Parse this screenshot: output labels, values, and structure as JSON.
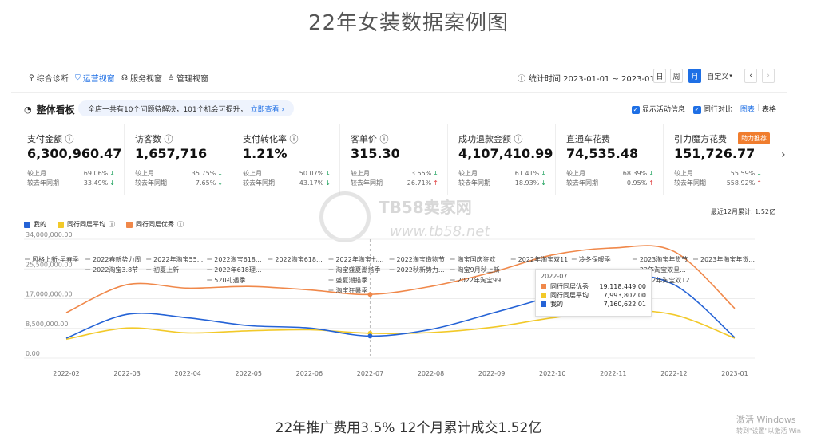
{
  "page_title": "22年女装数据案例图",
  "nav": {
    "tabs": [
      {
        "label": "综合诊断"
      },
      {
        "label": "运营视窗"
      },
      {
        "label": "服务视窗"
      },
      {
        "label": "管理视窗"
      }
    ],
    "stat_time": "统计时间 2023-01-01 ~ 2023-01-31",
    "period_buttons": [
      "日",
      "周",
      "月",
      "自定义"
    ],
    "prev": "‹",
    "next": "›"
  },
  "overview": {
    "title": "整体看板",
    "notice": "全店一共有10个问题待解决，101个机会可提升，",
    "notice_link": "立即查看 ›",
    "opt_activity": "显示活动信息",
    "opt_peer": "同行对比",
    "opt_chart": "图表",
    "opt_sep": "|",
    "opt_table": "表格"
  },
  "cards": [
    {
      "name": "支付金额 ⓘ",
      "value": "6,300,960.47",
      "r1_label": "较上月",
      "r1_val": "69.06%",
      "r1_dir": "↓",
      "r2_label": "较去年同期",
      "r2_val": "33.49%",
      "r2_dir": "↓"
    },
    {
      "name": "访客数 ⓘ",
      "value": "1,657,716",
      "r1_label": "较上月",
      "r1_val": "35.75%",
      "r1_dir": "↓",
      "r2_label": "较去年同期",
      "r2_val": "7.65%",
      "r2_dir": "↓"
    },
    {
      "name": "支付转化率 ⓘ",
      "value": "1.21%",
      "r1_label": "较上月",
      "r1_val": "50.07%",
      "r1_dir": "↓",
      "r2_label": "较去年同期",
      "r2_val": "43.17%",
      "r2_dir": "↓"
    },
    {
      "name": "客单价 ⓘ",
      "value": "315.30",
      "r1_label": "较上月",
      "r1_val": "3.55%",
      "r1_dir": "↓",
      "r2_label": "较去年同期",
      "r2_val": "26.71%",
      "r2_dir": "↑"
    },
    {
      "name": "成功退款金额 ⓘ",
      "value": "4,107,410.99",
      "r1_label": "较上月",
      "r1_val": "61.41%",
      "r1_dir": "↓",
      "r2_label": "较去年同期",
      "r2_val": "18.93%",
      "r2_dir": "↓"
    },
    {
      "name": "直通车花费",
      "value": "74,535.48",
      "r1_label": "较上月",
      "r1_val": "68.39%",
      "r1_dir": "↓",
      "r2_label": "较去年同期",
      "r2_val": "0.95%",
      "r2_dir": "↑"
    },
    {
      "name": "引力魔方花费",
      "value": "151,726.77",
      "r1_label": "较上月",
      "r1_val": "55.59%",
      "r1_dir": "↓",
      "r2_label": "较去年同期",
      "r2_val": "558.92%",
      "r2_dir": "↑",
      "badge": "助力推荐"
    }
  ],
  "recent_total": "最近12月累计: 1.52亿",
  "watermark": {
    "text1": "TB58卖家网",
    "text2": "www.tb58.net"
  },
  "colors": {
    "mine": "#2563d6",
    "peer_avg": "#f2c929",
    "peer_top": "#f0884a",
    "accent": "#1e6fe5"
  },
  "chart_data": {
    "type": "line",
    "categories": [
      "2022-02",
      "2022-03",
      "2022-04",
      "2022-05",
      "2022-06",
      "2022-07",
      "2022-08",
      "2022-09",
      "2022-10",
      "2022-11",
      "2022-12",
      "2023-01"
    ],
    "y_ticks": [
      "0.00",
      "8,500,000.00",
      "17,000,000.00",
      "25,500,000.00",
      "34,000,000.00"
    ],
    "ylim": [
      0,
      34000000
    ],
    "series": [
      {
        "name": "我的",
        "color": "#2563d6",
        "values": [
          5700000,
          12500000,
          11500000,
          9300000,
          8600000,
          6300000,
          8200000,
          12800000,
          17800000,
          23500000,
          21000000,
          5900000
        ]
      },
      {
        "name": "同行同层平均",
        "color": "#f2c929",
        "values": [
          5400000,
          8600000,
          7200000,
          7800000,
          8100000,
          7100000,
          7300000,
          8800000,
          11500000,
          13500000,
          12400000,
          5700000
        ]
      },
      {
        "name": "同行同层优秀",
        "color": "#f0884a",
        "values": [
          13000000,
          21000000,
          20000000,
          20500000,
          19500000,
          18200000,
          20500000,
          24500000,
          29500000,
          31500000,
          30500000,
          14200000
        ]
      }
    ],
    "events": [
      {
        "label": "风格上新-早春季",
        "x": "2022-02",
        "row": 0
      },
      {
        "label": "2022春新势力周",
        "x": "2022-03",
        "row": 0
      },
      {
        "label": "2022年淘宝55...",
        "x": "2022-04",
        "row": 0
      },
      {
        "label": "2022淘宝618...",
        "x": "2022-05",
        "row": 0
      },
      {
        "label": "2022淘宝618...",
        "x": "2022-06",
        "row": 0
      },
      {
        "label": "2022年淘宝七...",
        "x": "2022-07",
        "row": 0
      },
      {
        "label": "2022淘宝造物节",
        "x": "2022-08",
        "row": 0
      },
      {
        "label": "淘宝国庆狂欢",
        "x": "2022-09",
        "row": 0
      },
      {
        "label": "2022年淘宝双11",
        "x": "2022-10",
        "row": 0
      },
      {
        "label": "冷冬保暖季",
        "x": "2022-11",
        "row": 0
      },
      {
        "label": "2023淘宝年货节",
        "x": "2022-12",
        "row": 0
      },
      {
        "label": "2023年淘宝年货...",
        "x": "2023-01",
        "row": 0
      },
      {
        "label": "2022淘宝3.8节",
        "x": "2022-03",
        "row": 1
      },
      {
        "label": "初夏上新",
        "x": "2022-04",
        "row": 1
      },
      {
        "label": "2022年618理...",
        "x": "2022-05",
        "row": 1
      },
      {
        "label": "淘宝盛夏潮搭季",
        "x": "2022-07",
        "row": 1
      },
      {
        "label": "2022秋新势力...",
        "x": "2022-08",
        "row": 1
      },
      {
        "label": "淘宝9月秋上新",
        "x": "2022-09",
        "row": 1
      },
      {
        "label": "22年淘宝双旦...",
        "x": "2022-12",
        "row": 1
      },
      {
        "label": "520礼遇季",
        "x": "2022-05",
        "row": 2
      },
      {
        "label": "盛夏潮搭季",
        "x": "2022-07",
        "row": 2
      },
      {
        "label": "2022年淘宝99...",
        "x": "2022-09",
        "row": 2
      },
      {
        "label": "2022年淘宝双12",
        "x": "2022-12",
        "row": 2
      },
      {
        "label": "淘宝狂暑季",
        "x": "2022-07",
        "row": 3
      }
    ],
    "tooltip": {
      "title": "2022-07",
      "rows": [
        {
          "name": "同行同层优秀",
          "value": "19,118,449.00",
          "color": "#f0884a"
        },
        {
          "name": "同行同层平均",
          "value": "7,993,802.00",
          "color": "#f2c929"
        },
        {
          "name": "我的",
          "value": "7,160,622.01",
          "color": "#2563d6"
        }
      ]
    }
  },
  "caption": "22年推广费用3.5% 12个月累计成交1.52亿",
  "windows_activation": {
    "line1": "激活 Windows",
    "line2": "转到\"设置\"以激活 Win"
  }
}
